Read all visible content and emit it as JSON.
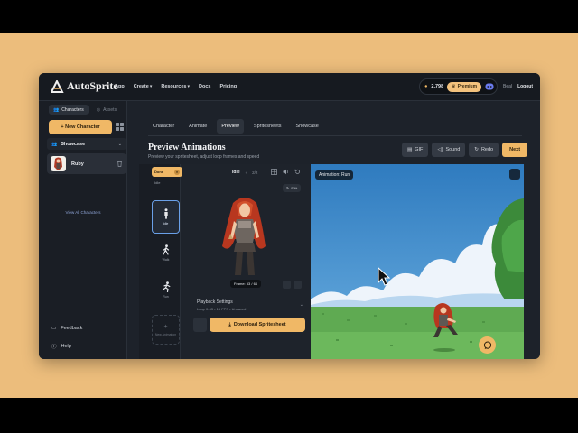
{
  "app": {
    "logo": "AutoSprite",
    "nav": {
      "app": "App",
      "create": "Create",
      "resources": "Resources",
      "docs": "Docs",
      "pricing": "Pricing"
    },
    "credits": "2,798",
    "premium": "Premium",
    "user": "Beal",
    "logout": "Logout"
  },
  "sidebar": {
    "tab_characters": "Characters",
    "tab_assets": "Assets",
    "new_character": "+ New Character",
    "group": "Showcase",
    "character_name": "Ruby",
    "view_all": "View All Characters",
    "feedback": "Feedback",
    "help": "Help"
  },
  "main": {
    "tabs": [
      "Character",
      "Animate",
      "Preview",
      "Spritesheets",
      "Showcase"
    ],
    "active_tab": "Preview",
    "title": "Preview Animations",
    "subtitle": "Preview your spritesheet, adjust loop frames and speed",
    "toolbar": {
      "gif": "GIF",
      "sound": "Sound",
      "redo": "Redo",
      "next": "Next"
    }
  },
  "animations": {
    "pill": "Done",
    "label": "Idle",
    "items": [
      {
        "label": "Idle",
        "icon": "stand-icon"
      },
      {
        "label": "Walk",
        "icon": "walk-icon"
      },
      {
        "label": "Run",
        "icon": "run-icon"
      }
    ],
    "new": "New Animation"
  },
  "preview": {
    "current": "Idle",
    "frame_counter": "2/2",
    "edit": "Edit",
    "frame_label": "Frame: 53 / 64",
    "playback_title": "Playback Settings",
    "playback_summary": "Loop 0-63 • 16 FPS • Unsaved",
    "download": "Download Spritesheet"
  },
  "scene": {
    "label": "Animation: Run"
  },
  "colors": {
    "accent": "#f0b866",
    "background": "#1d222a",
    "sky": "#3f86c7",
    "grass": "#5faa52"
  }
}
